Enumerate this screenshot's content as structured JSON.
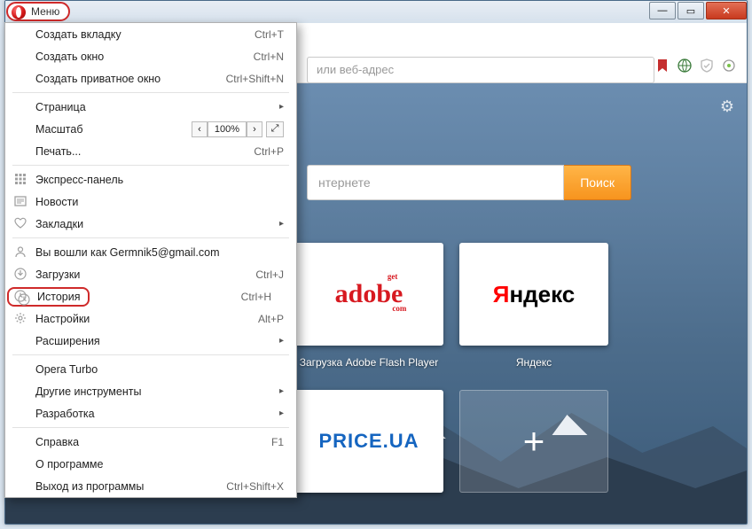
{
  "window": {
    "system_buttons": {
      "min": "—",
      "max": "▭",
      "close": "✕"
    }
  },
  "opera_button": {
    "label": "Меню"
  },
  "address_bar": {
    "placeholder": "или веб-адрес"
  },
  "toolbar_icons": {
    "bookmark": "bookmark-icon",
    "globe": "globe-icon",
    "shield": "shield-icon",
    "sync": "sync-icon"
  },
  "content": {
    "gear": "⚙",
    "search": {
      "placeholder": "нтернете",
      "button": "Поиск"
    },
    "tiles": [
      {
        "id": "lumpics",
        "caption": ""
      },
      {
        "id": "adobe",
        "caption": "Загрузка Adobe Flash Player",
        "text": "adobe"
      },
      {
        "id": "yandex",
        "caption": "Яндекс",
        "text": "Яндекс",
        "accent": "Я"
      },
      {
        "id": "priceua",
        "caption": "",
        "text": "PRICE.UA"
      },
      {
        "id": "plus",
        "caption": "",
        "glyph": "+"
      }
    ]
  },
  "menu": {
    "items": [
      {
        "label": "Создать вкладку",
        "shortcut": "Ctrl+T"
      },
      {
        "label": "Создать окно",
        "shortcut": "Ctrl+N"
      },
      {
        "label": "Создать приватное окно",
        "shortcut": "Ctrl+Shift+N"
      },
      {
        "sep": true
      },
      {
        "label": "Страница",
        "submenu": true
      },
      {
        "label": "Масштаб",
        "zoom": "100%"
      },
      {
        "label": "Печать...",
        "shortcut": "Ctrl+P"
      },
      {
        "sep": true
      },
      {
        "label": "Экспресс-панель",
        "icon": "grid"
      },
      {
        "label": "Новости",
        "icon": "news"
      },
      {
        "label": "Закладки",
        "icon": "heart",
        "submenu": true
      },
      {
        "sep": true
      },
      {
        "label": "Вы вошли как Germnik5@gmail.com",
        "icon": "account"
      },
      {
        "label": "Загрузки",
        "icon": "download",
        "shortcut": "Ctrl+J"
      },
      {
        "label": "История",
        "icon": "history",
        "shortcut": "Ctrl+H",
        "highlight": true
      },
      {
        "label": "Настройки",
        "icon": "settings",
        "shortcut": "Alt+P"
      },
      {
        "label": "Расширения",
        "submenu": true
      },
      {
        "sep": true
      },
      {
        "label": "Opera Turbo"
      },
      {
        "label": "Другие инструменты",
        "submenu": true
      },
      {
        "label": "Разработка",
        "submenu": true
      },
      {
        "sep": true
      },
      {
        "label": "Справка",
        "shortcut": "F1"
      },
      {
        "label": "О программе"
      },
      {
        "label": "Выход из программы",
        "shortcut": "Ctrl+Shift+X"
      }
    ]
  }
}
